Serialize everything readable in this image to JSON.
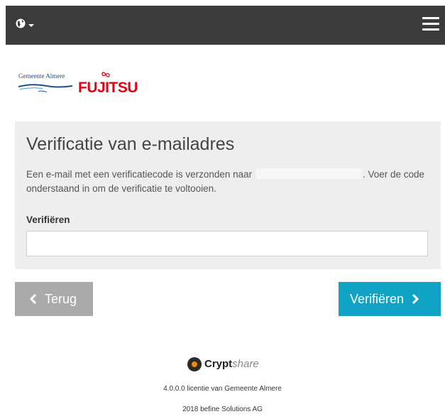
{
  "header": {
    "globe_icon": "globe-icon",
    "menu_icon": "hamburger-menu-icon"
  },
  "logos": {
    "municipality": "Gemeente Almere",
    "partner": "FUJITSU"
  },
  "verification": {
    "title": "Verificatie van e-mailadres",
    "description_before": "Een e-mail met een verificatiecode is verzonden naar",
    "description_after": ". Voer de code onderstaand in om de verificatie te voltooien.",
    "field_label": "Verifiëren",
    "field_value": ""
  },
  "buttons": {
    "back_label": "Terug",
    "verify_label": "Verifiëren"
  },
  "footer": {
    "brand_main": "Crypt",
    "brand_sub": "share",
    "license_text": "4.0.0.0 licentie van Gemeente Almere",
    "copyright": "2018 befine Solutions AG"
  },
  "colors": {
    "header_bg": "#3b3b3b",
    "panel_bg": "#eeeeee",
    "back_button": "#aaaaaa",
    "primary_button": "#11a3c5",
    "fujitsu_red": "#e50012"
  }
}
